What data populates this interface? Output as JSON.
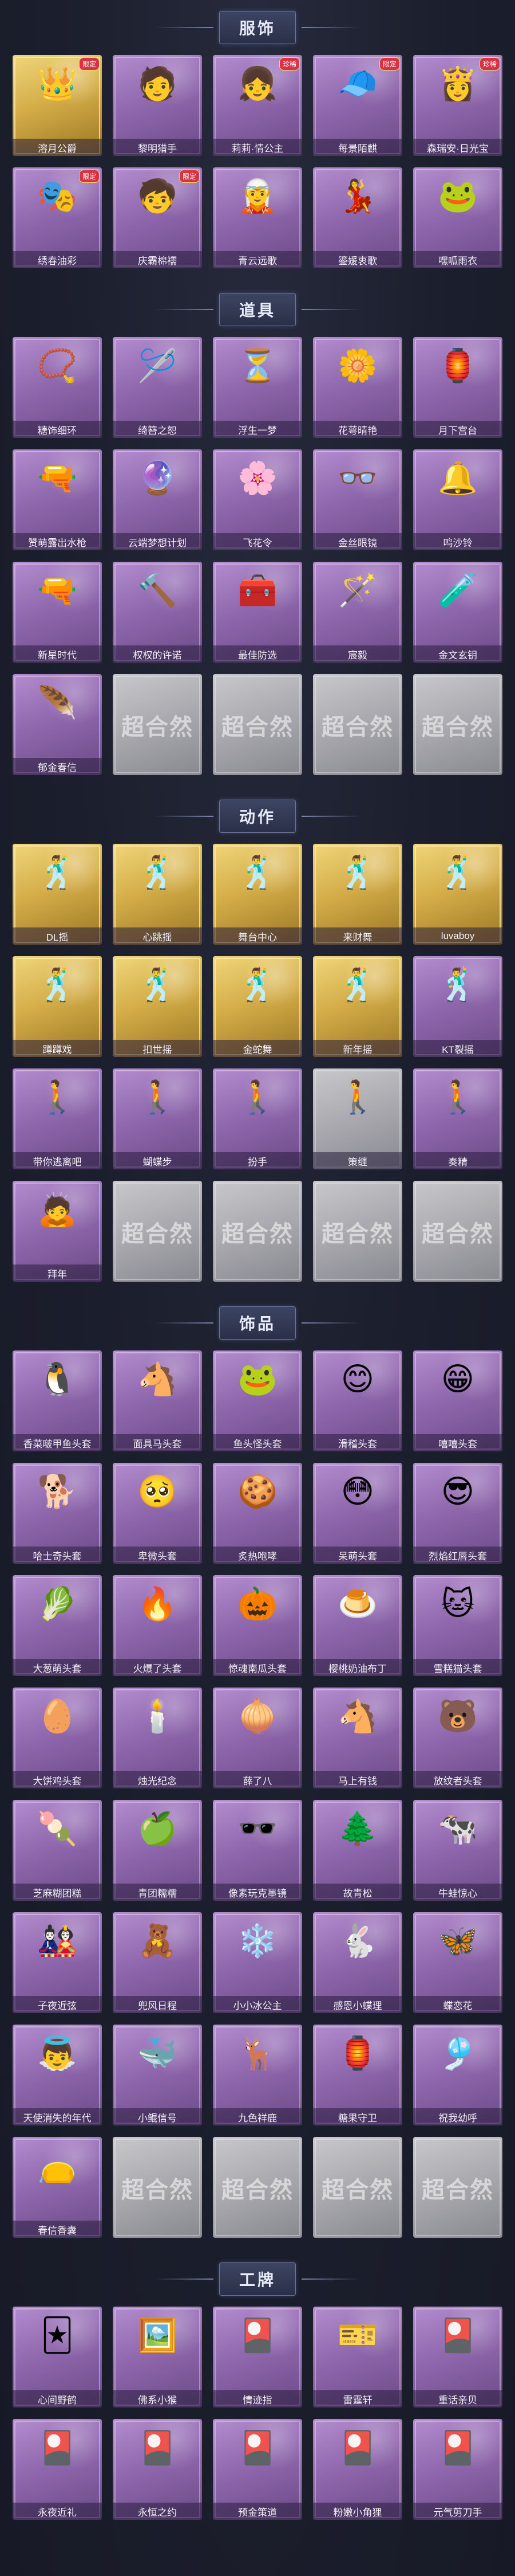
{
  "sections": [
    {
      "title": "服饰",
      "items": [
        {
          "label": "溶月公爵",
          "style": "gold",
          "icon": "👑",
          "badge": "限定"
        },
        {
          "label": "黎明猎手",
          "style": "purple",
          "icon": "🧑",
          "badge": ""
        },
        {
          "label": "莉莉·情公主",
          "style": "purple",
          "icon": "👧",
          "badge": "珍稀"
        },
        {
          "label": "每景陌麒",
          "style": "purple",
          "icon": "🧢",
          "badge": "限定"
        },
        {
          "label": "森瑞安·日光宝",
          "style": "purple",
          "icon": "👸",
          "badge": "珍稀"
        },
        {
          "label": "绣春油彩",
          "style": "purple",
          "icon": "🎭",
          "badge": "限定"
        },
        {
          "label": "庆霸棉襦",
          "style": "purple",
          "icon": "🧒",
          "badge": "限定"
        },
        {
          "label": "青云远歌",
          "style": "purple",
          "icon": "🧝",
          "badge": ""
        },
        {
          "label": "鎏媛衷歌",
          "style": "purple",
          "icon": "💃",
          "badge": ""
        },
        {
          "label": "嘿呱雨衣",
          "style": "purple",
          "icon": "🐸",
          "badge": ""
        }
      ]
    },
    {
      "title": "道具",
      "items": [
        {
          "label": "糖饰细环",
          "style": "purple",
          "icon": "📿",
          "badge": ""
        },
        {
          "label": "绮簪之恕",
          "style": "purple",
          "icon": "🪡",
          "badge": ""
        },
        {
          "label": "浮生一梦",
          "style": "purple",
          "icon": "⏳",
          "badge": ""
        },
        {
          "label": "花萼晴艳",
          "style": "purple",
          "icon": "🌼",
          "badge": ""
        },
        {
          "label": "月下宫台",
          "style": "purple",
          "icon": "🏮",
          "badge": ""
        },
        {
          "label": "赞萌露出水枪",
          "style": "purple",
          "icon": "🔫",
          "badge": ""
        },
        {
          "label": "云端梦想计划",
          "style": "purple",
          "icon": "🔮",
          "badge": ""
        },
        {
          "label": "飞花令",
          "style": "purple",
          "icon": "🌸",
          "badge": ""
        },
        {
          "label": "金丝眼镜",
          "style": "purple",
          "icon": "👓",
          "badge": ""
        },
        {
          "label": "鸣沙铃",
          "style": "purple",
          "icon": "🔔",
          "badge": ""
        },
        {
          "label": "新星时代",
          "style": "purple",
          "icon": "🔫",
          "badge": ""
        },
        {
          "label": "权权的许诺",
          "style": "purple",
          "icon": "🔨",
          "badge": ""
        },
        {
          "label": "最佳防选",
          "style": "purple",
          "icon": "🧰",
          "badge": ""
        },
        {
          "label": "宸毅",
          "style": "purple",
          "icon": "🪄",
          "badge": ""
        },
        {
          "label": "金文玄钥",
          "style": "purple",
          "icon": "🧪",
          "badge": ""
        },
        {
          "label": "郁金春信",
          "style": "purple",
          "icon": "🪶",
          "badge": ""
        },
        {
          "label": "",
          "style": "gray",
          "icon": "",
          "badge": ""
        },
        {
          "label": "",
          "style": "gray",
          "icon": "",
          "badge": ""
        },
        {
          "label": "",
          "style": "gray",
          "icon": "",
          "badge": ""
        },
        {
          "label": "",
          "style": "gray",
          "icon": "",
          "badge": ""
        }
      ]
    },
    {
      "title": "动作",
      "items": [
        {
          "label": "DL摇",
          "style": "gold",
          "icon": "🕺",
          "badge": ""
        },
        {
          "label": "心跳摇",
          "style": "gold",
          "icon": "🕺",
          "badge": ""
        },
        {
          "label": "舞台中心",
          "style": "gold",
          "icon": "🕺",
          "badge": ""
        },
        {
          "label": "来财舞",
          "style": "gold",
          "icon": "🕺",
          "badge": ""
        },
        {
          "label": "luvaboy",
          "style": "gold",
          "icon": "🕺",
          "badge": ""
        },
        {
          "label": "蹲蹲戏",
          "style": "gold",
          "icon": "🕺",
          "badge": ""
        },
        {
          "label": "扣世摇",
          "style": "gold",
          "icon": "🕺",
          "badge": ""
        },
        {
          "label": "金蛇舞",
          "style": "gold",
          "icon": "🕺",
          "badge": ""
        },
        {
          "label": "新年摇",
          "style": "gold",
          "icon": "🕺",
          "badge": ""
        },
        {
          "label": "KT裂摇",
          "style": "purple",
          "icon": "🕺",
          "badge": ""
        },
        {
          "label": "带你逃离吧",
          "style": "purple",
          "icon": "🚶",
          "badge": ""
        },
        {
          "label": "蝴蝶步",
          "style": "purple",
          "icon": "🚶",
          "badge": ""
        },
        {
          "label": "扮手",
          "style": "purple",
          "icon": "🚶",
          "badge": ""
        },
        {
          "label": "策缠",
          "style": "gray",
          "icon": "🚶",
          "badge": ""
        },
        {
          "label": "奏精",
          "style": "purple",
          "icon": "🚶",
          "badge": ""
        },
        {
          "label": "拜年",
          "style": "purple",
          "icon": "🙇",
          "badge": ""
        },
        {
          "label": "",
          "style": "gray",
          "icon": "",
          "badge": ""
        },
        {
          "label": "",
          "style": "gray",
          "icon": "",
          "badge": ""
        },
        {
          "label": "",
          "style": "gray",
          "icon": "",
          "badge": ""
        },
        {
          "label": "",
          "style": "gray",
          "icon": "",
          "badge": ""
        }
      ]
    },
    {
      "title": "饰品",
      "items": [
        {
          "label": "香菜啵甲鱼头套",
          "style": "purple",
          "icon": "🐧",
          "badge": ""
        },
        {
          "label": "面具马头套",
          "style": "purple",
          "icon": "🐴",
          "badge": ""
        },
        {
          "label": "鱼头怪头套",
          "style": "purple",
          "icon": "🐸",
          "badge": ""
        },
        {
          "label": "滑稽头套",
          "style": "purple",
          "icon": "😊",
          "badge": ""
        },
        {
          "label": "嘻嘻头套",
          "style": "purple",
          "icon": "😁",
          "badge": ""
        },
        {
          "label": "哈士奇头套",
          "style": "purple",
          "icon": "🐕",
          "badge": ""
        },
        {
          "label": "卑微头套",
          "style": "purple",
          "icon": "🥺",
          "badge": ""
        },
        {
          "label": "炙热咆哮",
          "style": "purple",
          "icon": "🍪",
          "badge": ""
        },
        {
          "label": "呆萌头套",
          "style": "purple",
          "icon": "😳",
          "badge": ""
        },
        {
          "label": "烈焰红唇头套",
          "style": "purple",
          "icon": "😎",
          "badge": ""
        },
        {
          "label": "大葱萌头套",
          "style": "purple",
          "icon": "🥬",
          "badge": ""
        },
        {
          "label": "火爆了头套",
          "style": "purple",
          "icon": "🔥",
          "badge": ""
        },
        {
          "label": "惊魂南瓜头套",
          "style": "purple",
          "icon": "🎃",
          "badge": ""
        },
        {
          "label": "樱桃奶油布丁",
          "style": "purple",
          "icon": "🍮",
          "badge": ""
        },
        {
          "label": "雪糕猫头套",
          "style": "purple",
          "icon": "🐱",
          "badge": ""
        },
        {
          "label": "大饼鸡头套",
          "style": "purple",
          "icon": "🥚",
          "badge": ""
        },
        {
          "label": "烛光纪念",
          "style": "purple",
          "icon": "🕯️",
          "badge": ""
        },
        {
          "label": "薛了八",
          "style": "purple",
          "icon": "🧅",
          "badge": ""
        },
        {
          "label": "马上有钱",
          "style": "purple",
          "icon": "🐴",
          "badge": ""
        },
        {
          "label": "放纹者头套",
          "style": "purple",
          "icon": "🐻",
          "badge": ""
        },
        {
          "label": "芝麻糊团糕",
          "style": "purple",
          "icon": "🍡",
          "badge": ""
        },
        {
          "label": "青团糯糯",
          "style": "purple",
          "icon": "🍏",
          "badge": ""
        },
        {
          "label": "像素玩克墨镜",
          "style": "purple",
          "icon": "🕶️",
          "badge": ""
        },
        {
          "label": "故青松",
          "style": "purple",
          "icon": "🌲",
          "badge": ""
        },
        {
          "label": "牛蛙惊心",
          "style": "purple",
          "icon": "🐄",
          "badge": ""
        },
        {
          "label": "子夜近弦",
          "style": "purple",
          "icon": "🎎",
          "badge": ""
        },
        {
          "label": "兜风日程",
          "style": "purple",
          "icon": "🧸",
          "badge": ""
        },
        {
          "label": "小小冰公主",
          "style": "purple",
          "icon": "❄️",
          "badge": ""
        },
        {
          "label": "感恩小蝶理",
          "style": "purple",
          "icon": "🐇",
          "badge": ""
        },
        {
          "label": "蝶恋花",
          "style": "purple",
          "icon": "🦋",
          "badge": ""
        },
        {
          "label": "天使消失的年代",
          "style": "purple",
          "icon": "👼",
          "badge": ""
        },
        {
          "label": "小鲲信号",
          "style": "purple",
          "icon": "🐳",
          "badge": ""
        },
        {
          "label": "九色祥鹿",
          "style": "purple",
          "icon": "🦌",
          "badge": ""
        },
        {
          "label": "糖果守卫",
          "style": "purple",
          "icon": "🏮",
          "badge": ""
        },
        {
          "label": "祝我幼呼",
          "style": "purple",
          "icon": "🎐",
          "badge": ""
        },
        {
          "label": "春信香囊",
          "style": "purple",
          "icon": "👝",
          "badge": ""
        },
        {
          "label": "",
          "style": "gray",
          "icon": "",
          "badge": ""
        },
        {
          "label": "",
          "style": "gray",
          "icon": "",
          "badge": ""
        },
        {
          "label": "",
          "style": "gray",
          "icon": "",
          "badge": ""
        },
        {
          "label": "",
          "style": "gray",
          "icon": "",
          "badge": ""
        }
      ]
    },
    {
      "title": "工牌",
      "items": [
        {
          "label": "心间野鹤",
          "style": "purple",
          "icon": "🃏",
          "badge": ""
        },
        {
          "label": "佛系小猴",
          "style": "purple",
          "icon": "🖼️",
          "badge": ""
        },
        {
          "label": "情迹指",
          "style": "purple",
          "icon": "🎴",
          "badge": ""
        },
        {
          "label": "雷霆轩",
          "style": "purple",
          "icon": "🎫",
          "badge": ""
        },
        {
          "label": "重话亲贝",
          "style": "purple",
          "icon": "🎴",
          "badge": ""
        },
        {
          "label": "永夜近礼",
          "style": "purple",
          "icon": "🎴",
          "badge": ""
        },
        {
          "label": "永恒之约",
          "style": "purple",
          "icon": "🎴",
          "badge": ""
        },
        {
          "label": "预金策道",
          "style": "purple",
          "icon": "🎴",
          "badge": ""
        },
        {
          "label": "粉嫩小角狸",
          "style": "purple",
          "icon": "🎴",
          "badge": ""
        },
        {
          "label": "元气剪刀手",
          "style": "purple",
          "icon": "🎴",
          "badge": ""
        }
      ]
    }
  ],
  "watermark_text": "超合然"
}
